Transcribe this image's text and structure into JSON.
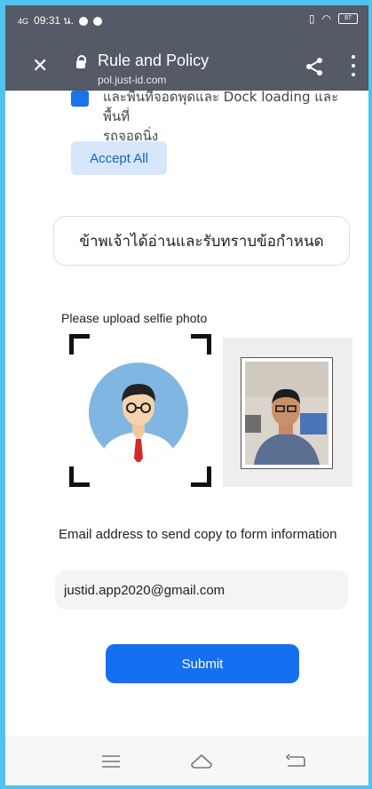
{
  "status": {
    "network": "4G",
    "time_label": "09:31 น.",
    "battery": "87"
  },
  "appbar": {
    "title": "Rule and Policy",
    "url": "pol.just-id.com"
  },
  "content": {
    "clipped_item_line1": "และพื้นที่จอดพุดและ Dock loading และพื้นที่",
    "clipped_item_line2": "รถจอดนิ่ง",
    "accept_all_label": "Accept All",
    "agreement_text": "ข้าพเจ้าได้อ่านและรับทราบข้อกำหนด",
    "selfie_label": "Please upload selfie photo",
    "email_label": "Email address to send copy to form information",
    "email_value": "justid.app2020@gmail.com",
    "submit_label": "Submit"
  },
  "icons": {
    "close": "close-icon",
    "lock": "lock-icon",
    "share": "share-icon",
    "more": "more-vert-icon",
    "nav_menu": "menu-icon",
    "nav_home": "home-icon",
    "nav_back": "back-icon"
  },
  "colors": {
    "appbar": "#545a66",
    "frame_border": "#4ec3ef",
    "primary": "#1470f0",
    "accept_bg": "#d7e6fb"
  }
}
